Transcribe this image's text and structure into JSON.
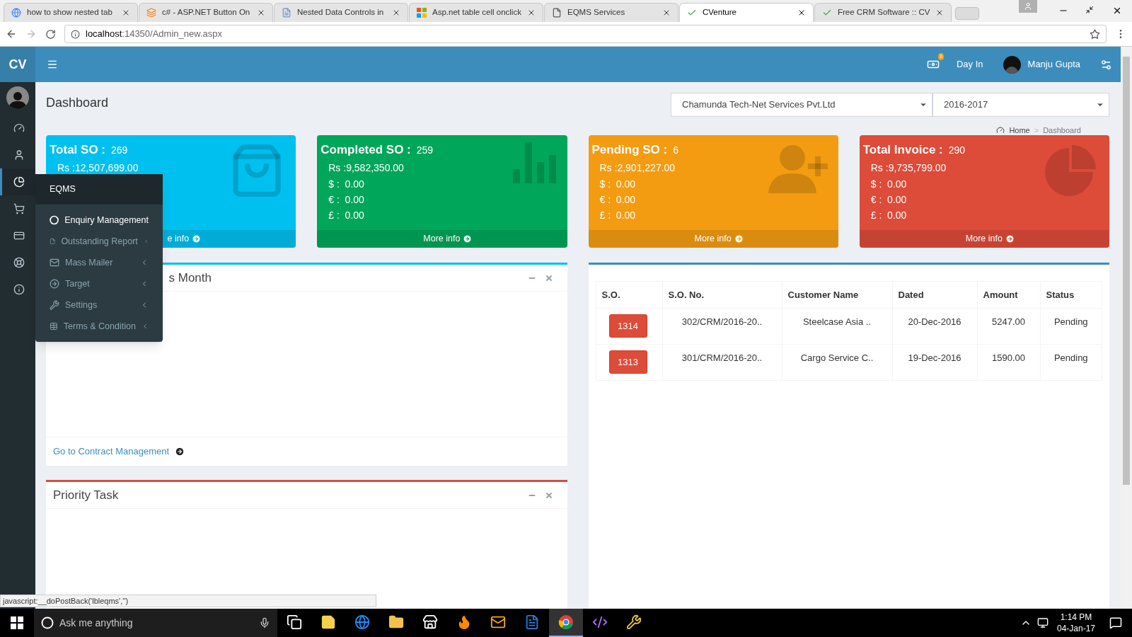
{
  "browser": {
    "tabs": [
      {
        "title": "how to show nested tab",
        "selected": false
      },
      {
        "title": "c# - ASP.NET Button On",
        "selected": false
      },
      {
        "title": "Nested Data Controls in",
        "selected": false
      },
      {
        "title": "Asp.net table cell onclick",
        "selected": false
      },
      {
        "title": "EQMS Services",
        "selected": false
      },
      {
        "title": "CVenture",
        "selected": true
      },
      {
        "title": "Free CRM Software :: CV",
        "selected": false
      }
    ],
    "address_host": "localhost",
    "address_path": ":14350/Admin_new.aspx"
  },
  "header": {
    "logo": "CV",
    "notification_count": "3",
    "day_in": "Day In",
    "user_name": "Manju Gupta"
  },
  "sidebar": {
    "items": [
      {
        "selected": false
      },
      {
        "selected": false
      },
      {
        "selected": true
      },
      {
        "selected": false
      },
      {
        "selected": false
      },
      {
        "selected": false
      },
      {
        "selected": false
      }
    ]
  },
  "flyout": {
    "title": "EQMS",
    "items": [
      {
        "label": "Enquiry Management",
        "selected": true,
        "expandable": false
      },
      {
        "label": "Outstanding Report",
        "selected": false,
        "expandable": true
      },
      {
        "label": "Mass Mailer",
        "selected": false,
        "expandable": true
      },
      {
        "label": "Target",
        "selected": false,
        "expandable": true
      },
      {
        "label": "Settings",
        "selected": false,
        "expandable": true
      },
      {
        "label": "Terms & Condition",
        "selected": false,
        "expandable": true
      }
    ]
  },
  "page": {
    "title": "Dashboard",
    "company": "Chamunda Tech-Net Services Pvt.Ltd",
    "year": "2016-2017",
    "breadcrumb": [
      "Home",
      "Dashboard"
    ],
    "breadcrumb_separator": ">"
  },
  "cards": [
    {
      "title": "Total SO :",
      "count": "269",
      "color": "#00c0ef",
      "lines": [
        "Rs :12,507,699.00"
      ],
      "footer": "e info"
    },
    {
      "title": "Completed SO :",
      "count": "259",
      "color": "#00a65a",
      "lines": [
        "Rs :9,582,350.00",
        "$ :  0.00",
        "€ :  0.00",
        "£ :  0.00"
      ],
      "footer": "More info"
    },
    {
      "title": "Pending SO :",
      "count": "6",
      "color": "#f39c12",
      "lines": [
        "Rs :2,901,227.00",
        "$ :  0.00",
        "€ :  0.00",
        "£ :  0.00"
      ],
      "footer": "More info"
    },
    {
      "title": "Total Invoice :",
      "count": "290",
      "color": "#dd4b39",
      "lines": [
        "Rs :9,735,799.00",
        "$ :  0.00",
        "€ :  0.00",
        "£ :  0.00"
      ],
      "footer": "More info"
    }
  ],
  "panels": [
    {
      "title": "s Month",
      "color": "#00c0ef",
      "link": "Go to Contract Management"
    },
    {
      "title": "Priority Task",
      "color": "#dd4b39"
    }
  ],
  "orders": {
    "columns": [
      "S.O.",
      "S.O. No.",
      "Customer Name",
      "Dated",
      "Amount",
      "Status"
    ],
    "rows": [
      {
        "cells": [
          "1314",
          "302/CRM/2016-20..",
          "Steelcase Asia ..",
          "20-Dec-2016",
          "5247.00",
          "Pending"
        ]
      },
      {
        "cells": [
          "1313",
          "301/CRM/2016-20..",
          "Cargo Service C..",
          "19-Dec-2016",
          "1590.00",
          "Pending"
        ]
      }
    ]
  },
  "status_text": "javascript:__doPostBack('lbleqms','')",
  "taskbar": {
    "search_placeholder": "Ask me anything",
    "time": "1:14 PM",
    "date": "04-Jan-17",
    "apps": [
      {
        "selected": false
      },
      {
        "selected": false
      },
      {
        "selected": false
      },
      {
        "selected": false
      },
      {
        "selected": false
      },
      {
        "selected": false
      },
      {
        "selected": false
      },
      {
        "selected": false
      },
      {
        "selected": true
      },
      {
        "selected": false
      },
      {
        "selected": false
      }
    ]
  }
}
